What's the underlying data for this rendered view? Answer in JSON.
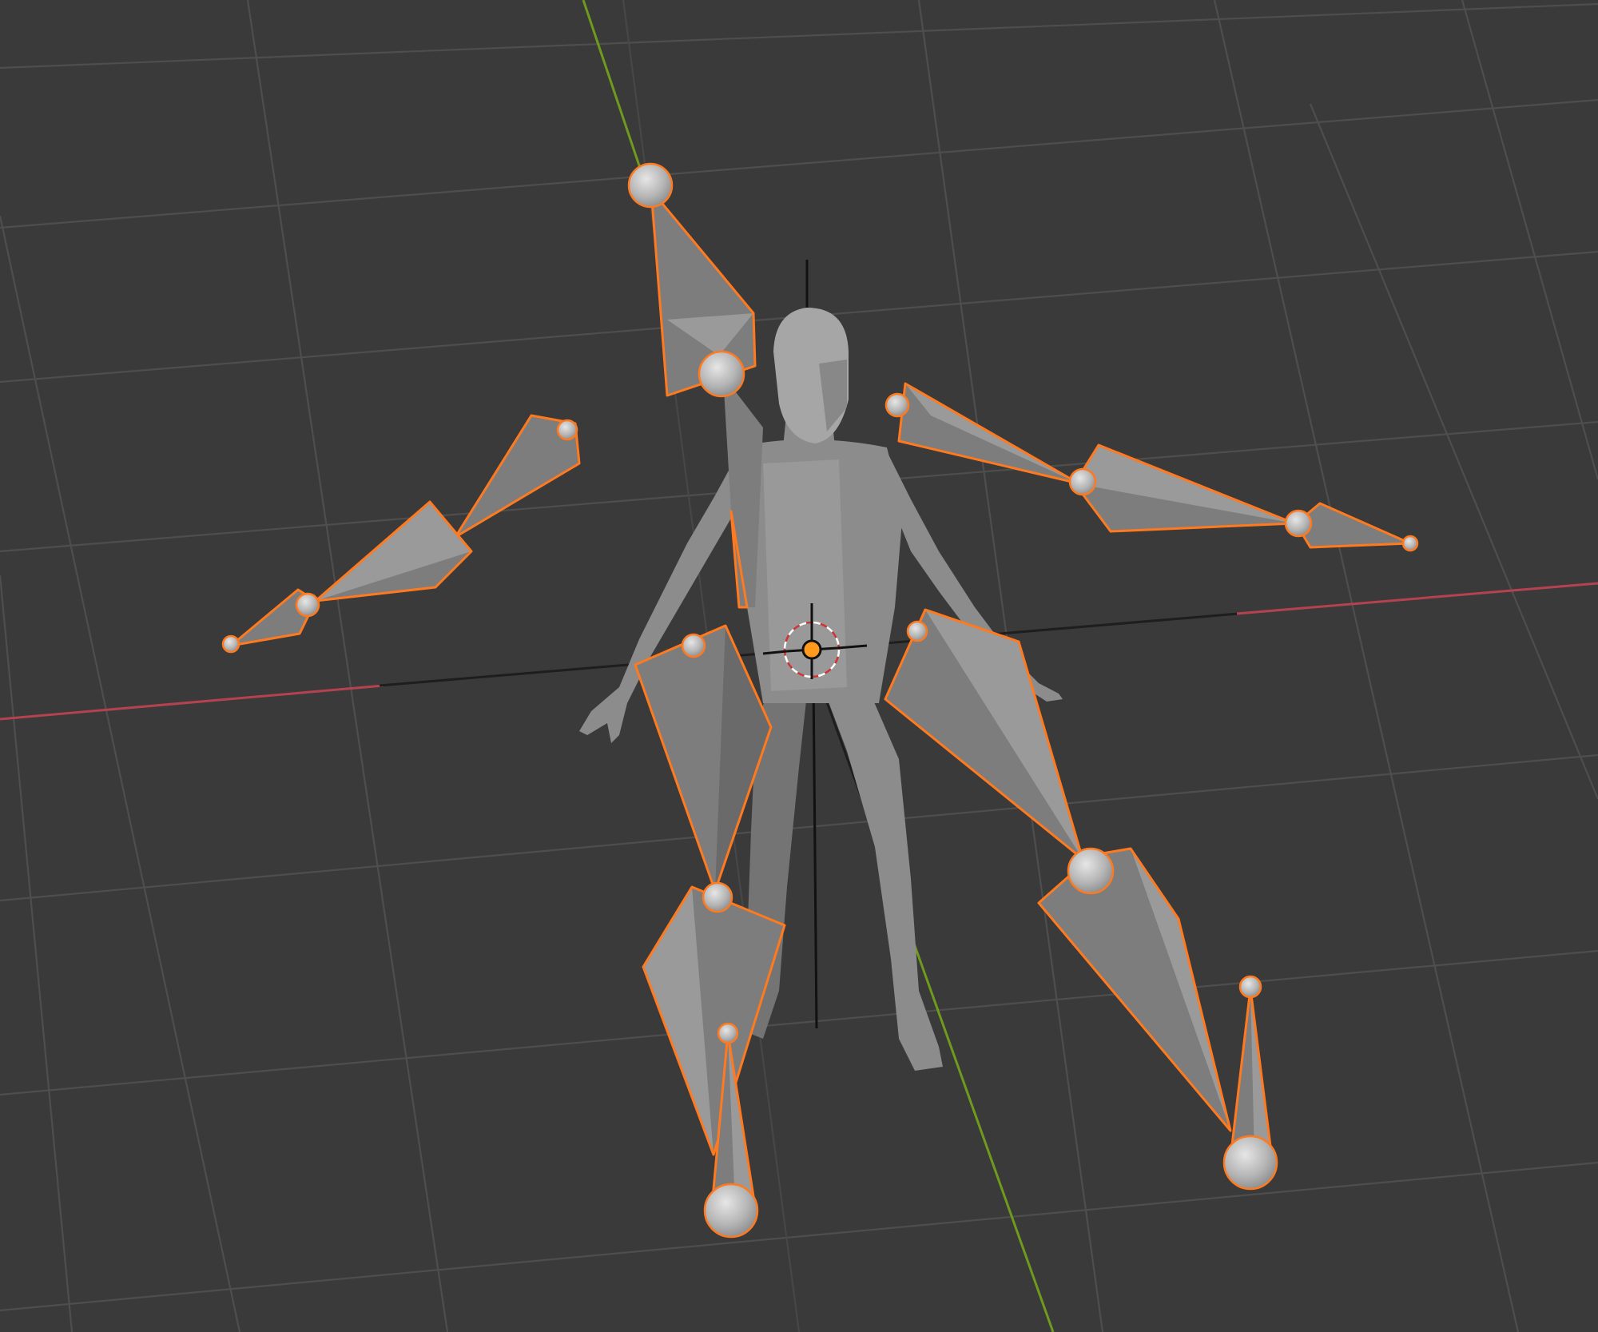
{
  "viewport": {
    "background_color": "#3a3a3a",
    "grid_color": "#4d4d4d",
    "x_axis_color": "#b5424f",
    "y_axis_color": "#6f9a1e",
    "selection_color": "#ff7a1f",
    "bone_color": "#7d7d7d",
    "mesh_color": "#8c8c8c"
  },
  "scene": {
    "mesh_object": "humanoid-mesh",
    "armature_object": "armature",
    "bone_count": 16,
    "bones": [
      "head-bone-upper",
      "head-bone-lower",
      "spine-bone",
      "left-upper-arm-bone",
      "left-forearm-bone",
      "left-hand-bone",
      "right-upper-arm-bone",
      "right-forearm-bone",
      "right-hand-bone",
      "left-thigh-bone",
      "left-shin-bone",
      "left-foot-bone",
      "right-thigh-bone",
      "right-shin-bone",
      "right-foot-bone",
      "hip-bone"
    ]
  },
  "icons": {
    "origin": "origin-dot-icon",
    "cursor": "3d-cursor-icon",
    "empty": "empty-axes-icon"
  }
}
